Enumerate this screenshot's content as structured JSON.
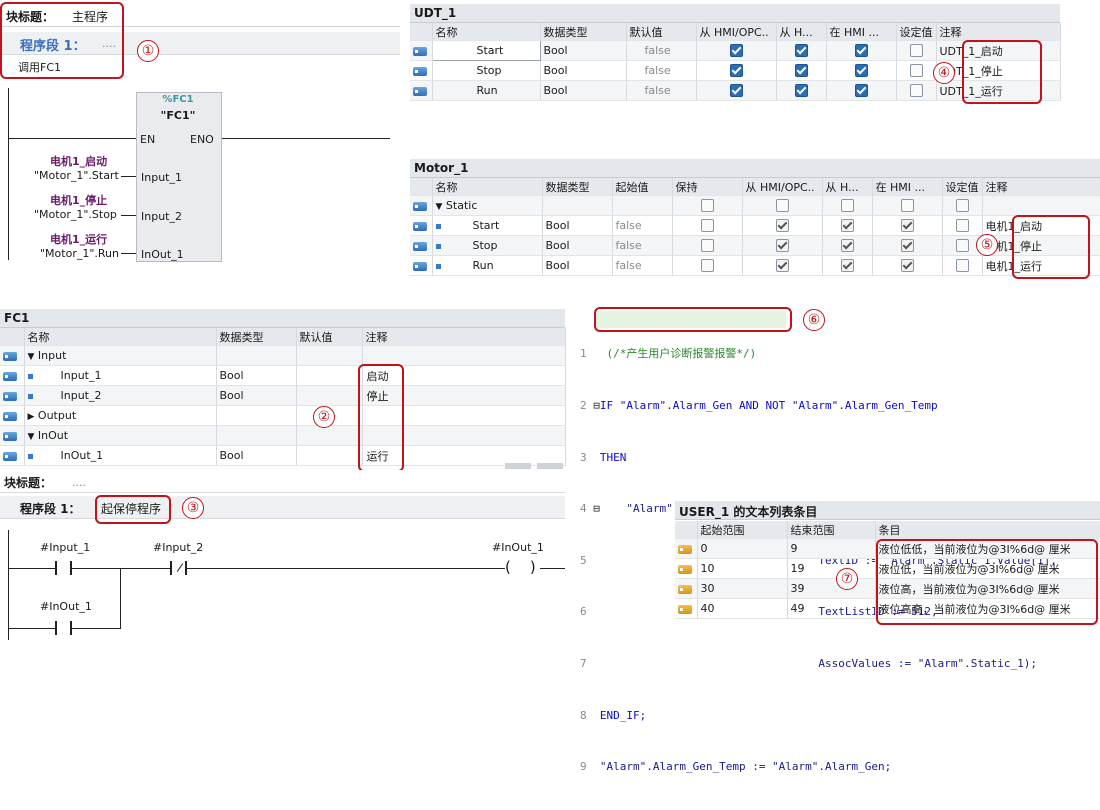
{
  "callouts": {
    "c1": "①",
    "c2": "②",
    "c3": "③",
    "c4": "④",
    "c5": "⑤",
    "c6": "⑥",
    "c7": "⑦"
  },
  "main_prog": {
    "block_title_label": "块标题：",
    "block_title_value": "主程序",
    "segment_label": "程序段 1：",
    "segment_value": "....",
    "comment": "调用FC1",
    "fc_addr": "%FC1",
    "fc_name": "\"FC1\"",
    "en": "EN",
    "eno": "ENO",
    "params": [
      {
        "label": "电机1_启动",
        "tag": "\"Motor_1\".Start",
        "pin": "Input_1"
      },
      {
        "label": "电机1_停止",
        "tag": "\"Motor_1\".Stop",
        "pin": "Input_2"
      },
      {
        "label": "电机1_运行",
        "tag": "\"Motor_1\".Run",
        "pin": "InOut_1"
      }
    ]
  },
  "udt": {
    "title": "UDT_1",
    "headers": [
      "名称",
      "数据类型",
      "默认值",
      "从 HMI/OPC..",
      "从 H...",
      "在 HMI ...",
      "设定值",
      "注释"
    ],
    "rows": [
      {
        "name": "Start",
        "type": "Bool",
        "default": "false",
        "comment": "UDT_1_启动"
      },
      {
        "name": "Stop",
        "type": "Bool",
        "default": "false",
        "comment": "UDT_1_停止"
      },
      {
        "name": "Run",
        "type": "Bool",
        "default": "false",
        "comment": "UDT_1_运行"
      }
    ]
  },
  "motor": {
    "title": "Motor_1",
    "headers": [
      "名称",
      "数据类型",
      "起始值",
      "保持",
      "从 HMI/OPC..",
      "从 H...",
      "在 HMI ...",
      "设定值",
      "注释"
    ],
    "static_label": "Static",
    "rows": [
      {
        "name": "Start",
        "type": "Bool",
        "start": "false",
        "comment": "电机1_启动"
      },
      {
        "name": "Stop",
        "type": "Bool",
        "start": "false",
        "comment": "电机1_停止"
      },
      {
        "name": "Run",
        "type": "Bool",
        "start": "false",
        "comment": "电机1_运行"
      }
    ]
  },
  "fc1": {
    "title": "FC1",
    "headers": [
      "名称",
      "数据类型",
      "默认值",
      "注释"
    ],
    "rows": [
      {
        "name": "Input",
        "type": "",
        "comment": "",
        "level": 0,
        "expand": "▼"
      },
      {
        "name": "Input_1",
        "type": "Bool",
        "comment": "启动",
        "level": 1,
        "expand": ""
      },
      {
        "name": "Input_2",
        "type": "Bool",
        "comment": "停止",
        "level": 1,
        "expand": ""
      },
      {
        "name": "Output",
        "type": "",
        "comment": "",
        "level": 0,
        "expand": "▶"
      },
      {
        "name": "InOut",
        "type": "",
        "comment": "",
        "level": 0,
        "expand": "▼"
      },
      {
        "name": "InOut_1",
        "type": "Bool",
        "comment": "运行",
        "level": 1,
        "expand": ""
      }
    ]
  },
  "ladder": {
    "block_title_label": "块标题：",
    "block_title_value": "....",
    "segment_label": "程序段 1：",
    "segment_value": "起保停程序",
    "c_input1": "#Input_1",
    "c_input2": "#Input_2",
    "coil": "#InOut_1",
    "c_inout1": "#InOut_1"
  },
  "scl": {
    "lines": [
      {
        "n": "1",
        "text": "(/*产生用户诊断报警报警*/)"
      },
      {
        "n": "2",
        "text": "IF \"Alarm\".Alarm_Gen AND NOT \"Alarm\".Alarm_Gen_Temp"
      },
      {
        "n": "3",
        "text": "THEN"
      },
      {
        "n": "4",
        "text": "    \"Alarm\".Ret_Val := Gen_UsrMsg(Mode := \"Alarm\".Mode,"
      },
      {
        "n": "5",
        "text": "                                 TextID := \"Alarm\".Static_1.Value[1],"
      },
      {
        "n": "6",
        "text": "                                 TextListID := 512,"
      },
      {
        "n": "7",
        "text": "                                 AssocValues := \"Alarm\".Static_1);"
      },
      {
        "n": "8",
        "text": "END_IF;"
      },
      {
        "n": "9",
        "text": "\"Alarm\".Alarm_Gen_Temp := \"Alarm\".Alarm_Gen;"
      }
    ]
  },
  "textlist": {
    "title": "USER_1 的文本列表条目",
    "headers": [
      "起始范围",
      "结束范围",
      "条目"
    ],
    "rows": [
      {
        "from": "0",
        "to": "9",
        "entry": "液位低低，当前液位为@3I%6d@ 厘米"
      },
      {
        "from": "10",
        "to": "19",
        "entry": "液位低，当前液位为@3I%6d@ 厘米"
      },
      {
        "from": "30",
        "to": "39",
        "entry": "液位高，当前液位为@3I%6d@ 厘米"
      },
      {
        "from": "40",
        "to": "49",
        "entry": "液位高高，当前液位为@3I%6d@ 厘米"
      }
    ]
  }
}
